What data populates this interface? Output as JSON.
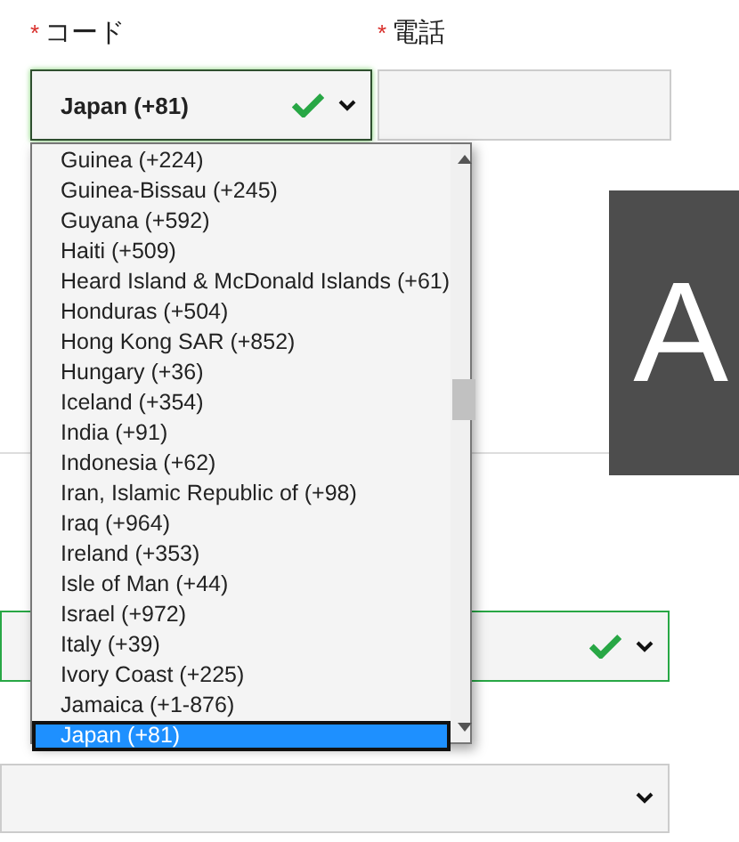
{
  "fields": [
    {
      "asterisk": "*",
      "label": "コード",
      "value": "Japan (+81)",
      "valid": true
    },
    {
      "asterisk": "*",
      "label": "電話"
    }
  ],
  "banner": {
    "text": "A"
  },
  "country_list": {
    "options": [
      {
        "label": "Guinea (+224)",
        "selected": false
      },
      {
        "label": "Guinea-Bissau (+245)",
        "selected": false
      },
      {
        "label": "Guyana (+592)",
        "selected": false
      },
      {
        "label": "Haiti (+509)",
        "selected": false
      },
      {
        "label": "Heard Island & McDonald Islands (+61)",
        "selected": false
      },
      {
        "label": "Honduras (+504)",
        "selected": false
      },
      {
        "label": "Hong Kong SAR (+852)",
        "selected": false
      },
      {
        "label": "Hungary (+36)",
        "selected": false
      },
      {
        "label": "Iceland (+354)",
        "selected": false
      },
      {
        "label": "India (+91)",
        "selected": false
      },
      {
        "label": "Indonesia (+62)",
        "selected": false
      },
      {
        "label": "Iran, Islamic Republic of (+98)",
        "selected": false
      },
      {
        "label": "Iraq (+964)",
        "selected": false
      },
      {
        "label": "Ireland (+353)",
        "selected": false
      },
      {
        "label": "Isle of Man (+44)",
        "selected": false
      },
      {
        "label": "Israel (+972)",
        "selected": false
      },
      {
        "label": "Italy (+39)",
        "selected": false
      },
      {
        "label": "Ivory Coast (+225)",
        "selected": false
      },
      {
        "label": "Jamaica (+1-876)",
        "selected": false
      },
      {
        "label": "Japan (+81)",
        "selected": true
      }
    ]
  },
  "selects": [
    {
      "valid": true
    },
    {
      "valid": false
    }
  ]
}
